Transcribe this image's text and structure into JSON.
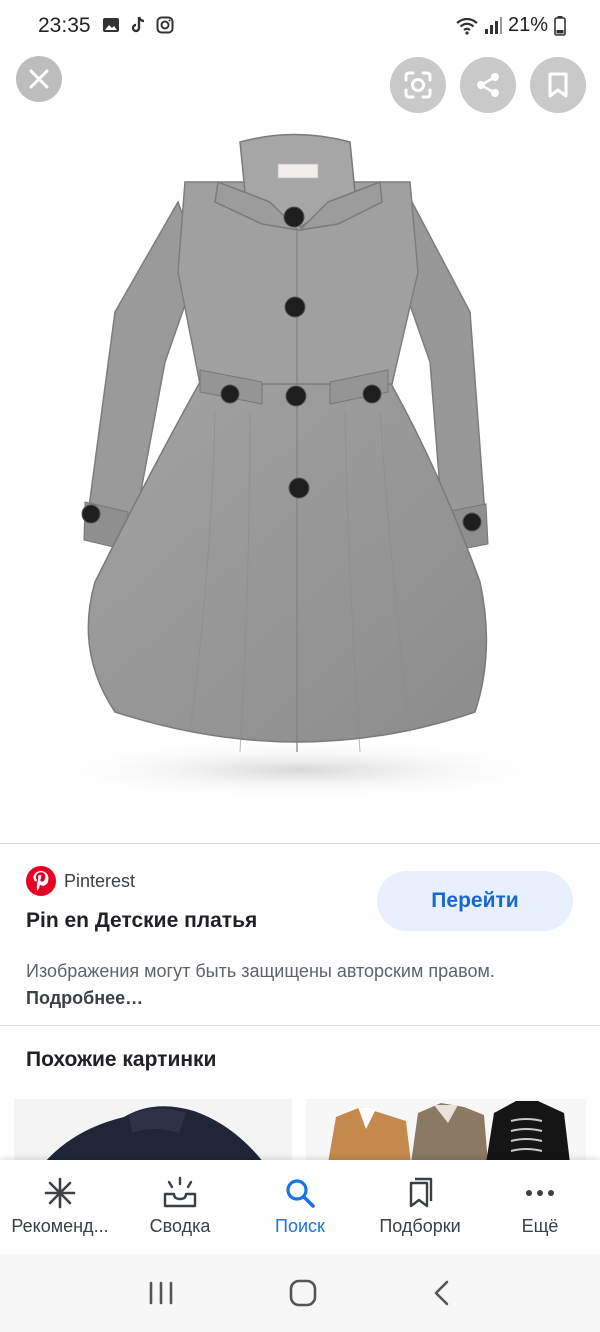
{
  "status": {
    "time": "23:35",
    "battery": "21%"
  },
  "colors": {
    "accent": "#1a73e8",
    "visit_bg": "#e8f0fe",
    "pinterest": "#e60023"
  },
  "result": {
    "source_name": "Pinterest",
    "title": "Pin en Детские платья",
    "visit_label": "Перейти",
    "copyright_text": "Изображения могут быть защищены авторским правом.",
    "more_link": "Подробнее…"
  },
  "similar": {
    "heading": "Похожие картинки"
  },
  "bottom_nav": {
    "items": [
      {
        "label": "Рекоменд...",
        "icon": "asterisk-icon"
      },
      {
        "label": "Сводка",
        "icon": "tray-icon"
      },
      {
        "label": "Поиск",
        "icon": "search-icon"
      },
      {
        "label": "Подборки",
        "icon": "collections-icon"
      },
      {
        "label": "Ещё",
        "icon": "more-icon"
      }
    ]
  }
}
